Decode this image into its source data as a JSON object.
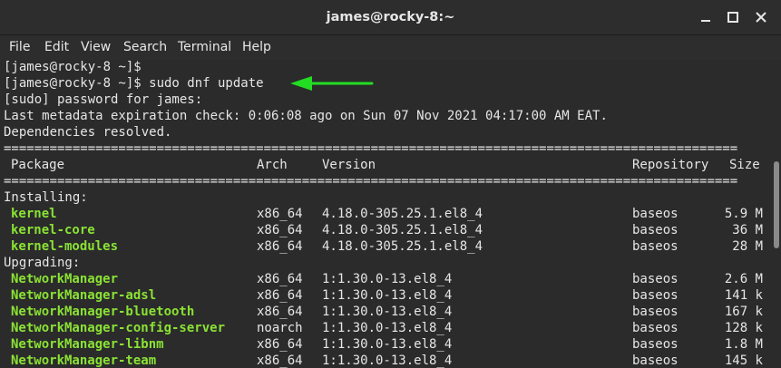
{
  "window": {
    "title": "james@rocky-8:~",
    "controls": {
      "minimize": "minimize",
      "maximize": "maximize",
      "close": "close"
    }
  },
  "menu": [
    "File",
    "Edit",
    "View",
    "Search",
    "Terminal",
    "Help"
  ],
  "terminal": {
    "lines": [
      "[james@rocky-8 ~]$",
      "[james@rocky-8 ~]$ sudo dnf update",
      "[sudo] password for james:",
      "Last metadata expiration check: 0:06:08 ago on Sun 07 Nov 2021 04:17:00 AM EAT.",
      "Dependencies resolved."
    ],
    "separator": "================================================================================================",
    "header": {
      "package": "Package",
      "arch": "Arch",
      "version": "Version",
      "repository": "Repository",
      "size": "Size"
    },
    "sections": [
      {
        "label": "Installing:",
        "rows": [
          {
            "name": "kernel",
            "arch": "x86_64",
            "version": "4.18.0-305.25.1.el8_4",
            "repo": "baseos",
            "size": "5.9 M"
          },
          {
            "name": "kernel-core",
            "arch": "x86_64",
            "version": "4.18.0-305.25.1.el8_4",
            "repo": "baseos",
            "size": "36 M"
          },
          {
            "name": "kernel-modules",
            "arch": "x86_64",
            "version": "4.18.0-305.25.1.el8_4",
            "repo": "baseos",
            "size": "28 M"
          }
        ]
      },
      {
        "label": "Upgrading:",
        "rows": [
          {
            "name": "NetworkManager",
            "arch": "x86_64",
            "version": "1:1.30.0-13.el8_4",
            "repo": "baseos",
            "size": "2.6 M"
          },
          {
            "name": "NetworkManager-adsl",
            "arch": "x86_64",
            "version": "1:1.30.0-13.el8_4",
            "repo": "baseos",
            "size": "141 k"
          },
          {
            "name": "NetworkManager-bluetooth",
            "arch": "x86_64",
            "version": "1:1.30.0-13.el8_4",
            "repo": "baseos",
            "size": "167 k"
          },
          {
            "name": "NetworkManager-config-server",
            "arch": "noarch",
            "version": "1:1.30.0-13.el8_4",
            "repo": "baseos",
            "size": "128 k"
          },
          {
            "name": "NetworkManager-libnm",
            "arch": "x86_64",
            "version": "1:1.30.0-13.el8_4",
            "repo": "baseos",
            "size": "1.8 M"
          },
          {
            "name": "NetworkManager-team",
            "arch": "x86_64",
            "version": "1:1.30.0-13.el8_4",
            "repo": "baseos",
            "size": "145 k"
          }
        ]
      }
    ]
  },
  "annotation": {
    "arrow_color": "#22dd22"
  },
  "colors": {
    "package_name": "#8ae234",
    "text": "#e6e6e6",
    "background": "#2b2b2b"
  }
}
